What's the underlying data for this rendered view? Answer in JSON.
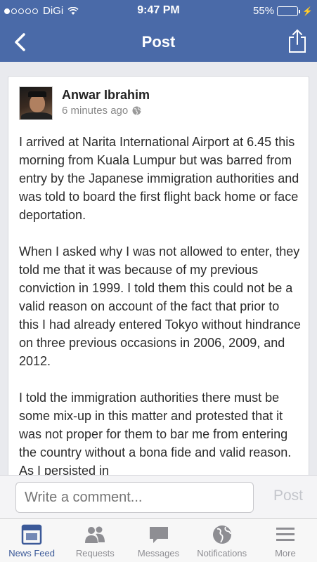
{
  "status": {
    "carrier": "DiGi",
    "time": "9:47 PM",
    "battery": "55%"
  },
  "nav": {
    "title": "Post"
  },
  "post": {
    "author": "Anwar Ibrahim",
    "timestamp": "6 minutes ago",
    "paragraphs": [
      "I arrived at Narita International Airport at 6.45 this morning from Kuala Lumpur but was barred from entry by the Japanese immigration authorities and was told to board the first flight back home or face deportation.",
      "When I asked why I was not allowed to enter, they told me that it was because of my previous conviction in 1999. I told them this could not be a valid reason on account of the fact that prior to this I had already entered Tokyo without hindrance on three previous occasions in 2006, 2009, and 2012.",
      "I told the immigration authorities there must be some mix-up in this matter and protested that it was not proper for them to bar me from entering the country without a bona fide and valid reason. As I persisted in"
    ]
  },
  "comment": {
    "placeholder": "Write a comment...",
    "post_label": "Post"
  },
  "tabs": [
    {
      "label": "News Feed",
      "icon": "news-feed-icon",
      "active": true
    },
    {
      "label": "Requests",
      "icon": "friend-requests-icon",
      "active": false
    },
    {
      "label": "Messages",
      "icon": "messages-icon",
      "active": false
    },
    {
      "label": "Notifications",
      "icon": "globe-notifications-icon",
      "active": false
    },
    {
      "label": "More",
      "icon": "menu-icon",
      "active": false
    }
  ],
  "colors": {
    "brand": "#4a6aa8",
    "active_tab": "#3b5998"
  }
}
